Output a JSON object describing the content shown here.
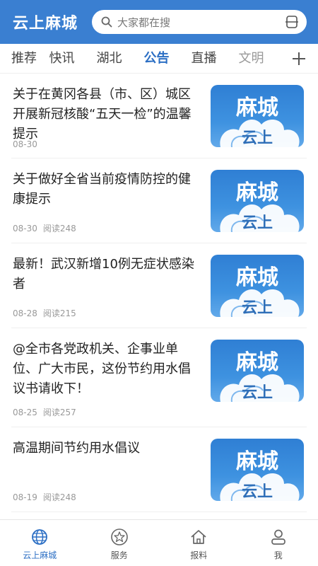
{
  "header": {
    "app_title": "云上麻城",
    "search_placeholder": "大家都在搜"
  },
  "tabs": [
    {
      "label": "推荐"
    },
    {
      "label": "快讯"
    },
    {
      "label": "湖北"
    },
    {
      "label": "公告"
    },
    {
      "label": "直播"
    },
    {
      "label": "文明"
    }
  ],
  "active_tab": "公告",
  "news": [
    {
      "title": "关于在黄冈各县（市、区）城区开展新冠核酸“五天一检”的温馨提示",
      "date": "08-30",
      "reads": ""
    },
    {
      "title": "关于做好全省当前疫情防控的健康提示",
      "date": "08-30",
      "reads": "阅读248"
    },
    {
      "title": "最新！武汉新增10例无症状感染者",
      "date": "08-28",
      "reads": "阅读215"
    },
    {
      "title": "@全市各党政机关、企事业单位、广大市民，这份节约用水倡议书请收下！",
      "date": "08-25",
      "reads": "阅读257"
    },
    {
      "title": "高温期间节约用水倡议",
      "date": "08-19",
      "reads": "阅读248"
    }
  ],
  "thumbnail": {
    "line1": "麻城",
    "line2": "云上"
  },
  "bottom_nav": [
    {
      "label": "云上麻城",
      "icon": "globe-icon"
    },
    {
      "label": "服务",
      "icon": "star-icon"
    },
    {
      "label": "报料",
      "icon": "house-icon"
    },
    {
      "label": "我",
      "icon": "person-icon"
    }
  ],
  "colors": {
    "brand": "#3a7fd1",
    "active": "#2c6fc4"
  }
}
